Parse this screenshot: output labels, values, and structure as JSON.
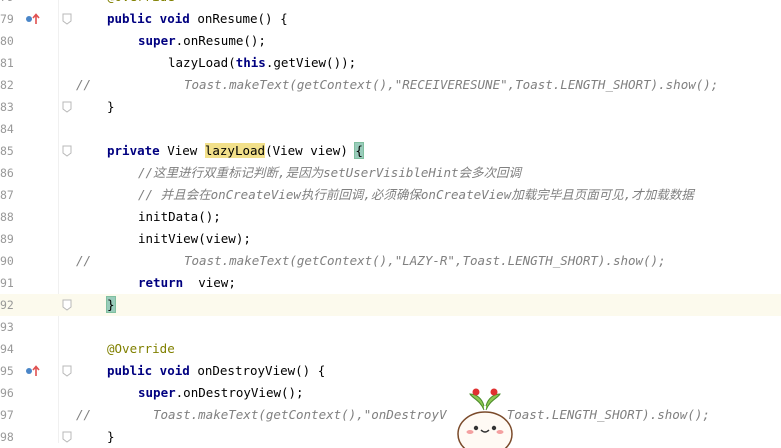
{
  "lines": [
    {
      "ln": "79",
      "code": [
        {
          "t": "@Override",
          "c": "an"
        }
      ]
    },
    {
      "ln": "79",
      "code": [
        {
          "t": "public void ",
          "c": "kw"
        },
        {
          "t": "onResume() {"
        }
      ]
    },
    {
      "ln": "80",
      "code": [
        {
          "t": "super",
          "c": "kw"
        },
        {
          "t": ".onResume();"
        }
      ]
    },
    {
      "ln": "81",
      "code": [
        {
          "t": "lazyLoad("
        },
        {
          "t": "this",
          "c": "kw"
        },
        {
          "t": ".getView());"
        }
      ]
    },
    {
      "ln": "82",
      "code": [
        {
          "t": "Toast.",
          "c": "cm"
        },
        {
          "t": "makeText",
          "c": "cm"
        },
        {
          "t": "(getContext(),\"RECEIVERESUNE\",Toast.LENGTH_SHORT).show();",
          "c": "cm"
        }
      ]
    },
    {
      "ln": "83",
      "code": [
        {
          "t": "}"
        }
      ]
    },
    {
      "ln": "84",
      "code": []
    },
    {
      "ln": "85",
      "code": [
        {
          "t": "private ",
          "c": "kw"
        },
        {
          "t": "View "
        },
        {
          "t": "lazyLoad",
          "c": "hl-lazy"
        },
        {
          "t": "(View view) "
        },
        {
          "t": "{",
          "c": "brace-hl"
        }
      ]
    },
    {
      "ln": "86",
      "code": [
        {
          "t": "//这里进行双重标记判断,是因为setUserVisibleHint会多次回调",
          "c": "cm"
        }
      ]
    },
    {
      "ln": "87",
      "code": [
        {
          "t": "// 并且会在onCreateView执行前回调,必须确保onCreateView加载完毕且页面可见,才加载数据",
          "c": "cm"
        }
      ]
    },
    {
      "ln": "88",
      "code": [
        {
          "t": "initData();"
        }
      ]
    },
    {
      "ln": "89",
      "code": [
        {
          "t": "initView(view);"
        }
      ]
    },
    {
      "ln": "90",
      "code": [
        {
          "t": "Toast.makeText(getContext(),\"LAZY-R\",Toast.LENGTH_SHORT).show();",
          "c": "cm"
        }
      ]
    },
    {
      "ln": "91",
      "code": [
        {
          "t": "return ",
          "c": "kw"
        },
        {
          "t": " view;"
        }
      ]
    },
    {
      "ln": "92",
      "code": [
        {
          "t": "}",
          "c": "brace-hl"
        }
      ]
    },
    {
      "ln": "93",
      "code": []
    },
    {
      "ln": "94",
      "code": [
        {
          "t": "@Override",
          "c": "an"
        }
      ]
    },
    {
      "ln": "95",
      "code": [
        {
          "t": "public void ",
          "c": "kw"
        },
        {
          "t": "onDestroyView() {"
        }
      ]
    },
    {
      "ln": "96",
      "code": [
        {
          "t": "super",
          "c": "kw"
        },
        {
          "t": ".onDestroyView();"
        }
      ]
    },
    {
      "ln": "97",
      "code": [
        {
          "t": "Toast.makeText(getContext(),\"onDestroyV",
          "c": "cm"
        },
        {
          "t": "        "
        },
        {
          "t": "Toast.LENGTH_SHORT).show();",
          "c": "cm"
        }
      ]
    },
    {
      "ln": "98",
      "code": [
        {
          "t": "}"
        }
      ]
    }
  ],
  "line_comment_marker": "//",
  "colors": {
    "keyword": "#000080",
    "comment": "#808080",
    "annotation": "#808000",
    "search_highlight": "#f2e08a",
    "brace_match": "#99ccbb",
    "current_line": "#fcfaed",
    "gutter_arrow": "#e05050",
    "gutter_circle": "#4a86c8"
  },
  "gutter": {
    "override_icons": [
      "override-icon",
      "override-icon"
    ]
  },
  "mascot": {
    "icon": "mascot-icon"
  }
}
